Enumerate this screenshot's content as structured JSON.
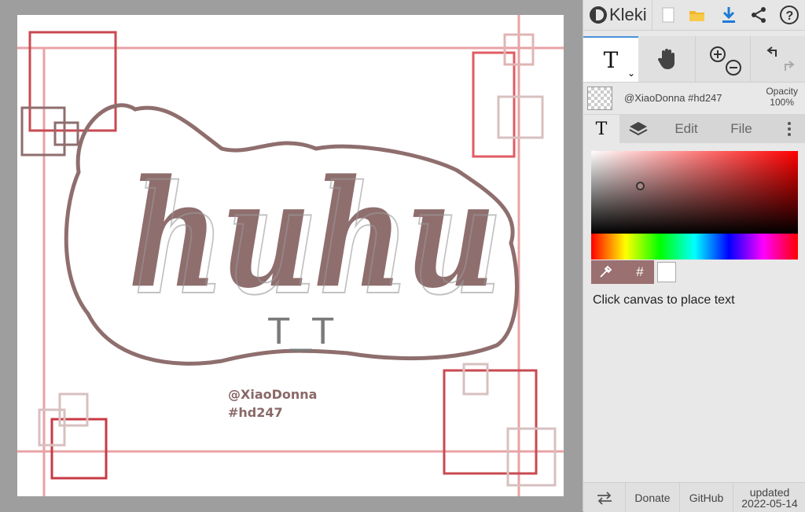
{
  "app": {
    "logo_text": "Kleki"
  },
  "topbar": {
    "buttons": [
      {
        "name": "new-file-icon",
        "label": "New"
      },
      {
        "name": "open-folder-icon",
        "label": "Open"
      },
      {
        "name": "download-icon",
        "label": "Save"
      },
      {
        "name": "share-icon",
        "label": "Share"
      },
      {
        "name": "help-icon",
        "label": "Help"
      }
    ]
  },
  "toolbar": {
    "text_tool_glyph": "T",
    "active_tool": "text"
  },
  "layer": {
    "name": "@XiaoDonna #hd247",
    "opacity_label": "Opacity",
    "opacity_value": "100%"
  },
  "tabs": {
    "text_tab": "T",
    "edit": "Edit",
    "file": "File"
  },
  "color": {
    "current": "#9a7070",
    "secondary": "#ffffff",
    "hex_label": "#"
  },
  "hint": "Click canvas to place text",
  "footer": {
    "donate": "Donate",
    "github": "GitHub",
    "updated_label": "updated",
    "updated_date": "2022-05-14"
  },
  "artwork": {
    "title": "huhu",
    "emoticon": "T_T",
    "credit_line1": "@XiaoDonna",
    "credit_line2": "#hd247",
    "colors": {
      "brown": "#8f6e6e",
      "pink": "#e8a3a5",
      "red": "#c94a52",
      "light": "#d8c0c0"
    }
  }
}
